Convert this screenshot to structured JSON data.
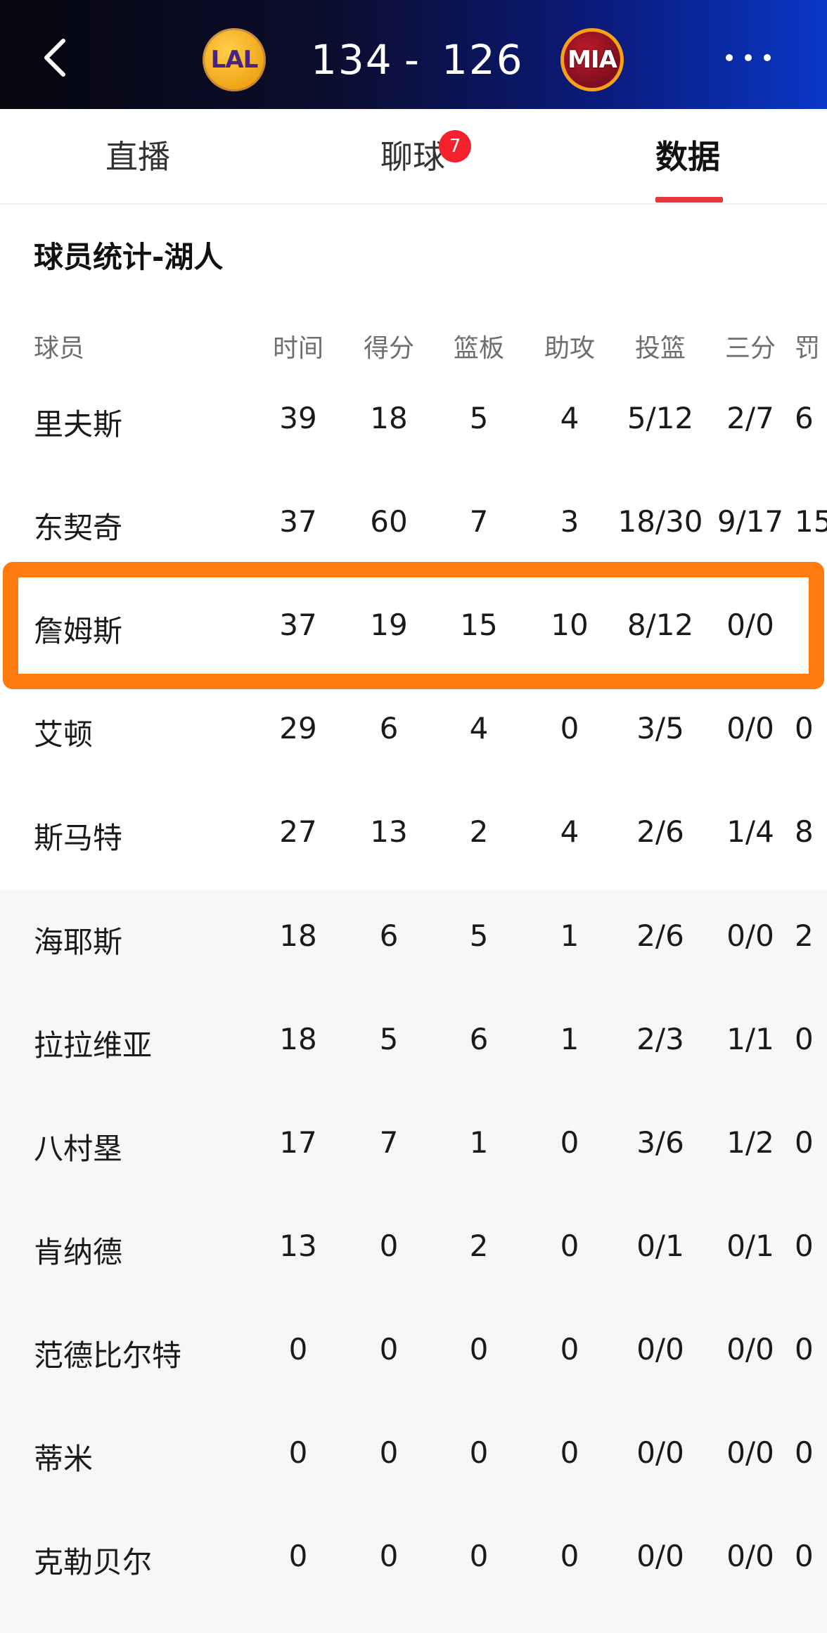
{
  "header": {
    "home_logo_text": "LAL",
    "away_logo_text": "MIA",
    "home_score": "134",
    "separator": "-",
    "away_score": "126"
  },
  "tabs": [
    {
      "label": "直播"
    },
    {
      "label": "聊球",
      "badge": "7"
    },
    {
      "label": "数据",
      "active": true
    }
  ],
  "section_title": "球员统计-湖人",
  "columns": [
    "球员",
    "时间",
    "得分",
    "篮板",
    "助攻",
    "投篮",
    "三分",
    "罚"
  ],
  "rows": [
    {
      "name": "里夫斯",
      "time": "39",
      "pts": "18",
      "reb": "5",
      "ast": "4",
      "fg": "5/12",
      "tp": "2/7",
      "ft": "6"
    },
    {
      "name": "东契奇",
      "time": "37",
      "pts": "60",
      "reb": "7",
      "ast": "3",
      "fg": "18/30",
      "tp": "9/17",
      "ft": "15"
    },
    {
      "name": "詹姆斯",
      "time": "37",
      "pts": "19",
      "reb": "15",
      "ast": "10",
      "fg": "8/12",
      "tp": "0/0",
      "ft": ""
    },
    {
      "name": "艾顿",
      "time": "29",
      "pts": "6",
      "reb": "4",
      "ast": "0",
      "fg": "3/5",
      "tp": "0/0",
      "ft": "0"
    },
    {
      "name": "斯马特",
      "time": "27",
      "pts": "13",
      "reb": "2",
      "ast": "4",
      "fg": "2/6",
      "tp": "1/4",
      "ft": "8"
    },
    {
      "name": "海耶斯",
      "time": "18",
      "pts": "6",
      "reb": "5",
      "ast": "1",
      "fg": "2/6",
      "tp": "0/0",
      "ft": "2"
    },
    {
      "name": "拉拉维亚",
      "time": "18",
      "pts": "5",
      "reb": "6",
      "ast": "1",
      "fg": "2/3",
      "tp": "1/1",
      "ft": "0"
    },
    {
      "name": "八村塁",
      "time": "17",
      "pts": "7",
      "reb": "1",
      "ast": "0",
      "fg": "3/6",
      "tp": "1/2",
      "ft": "0"
    },
    {
      "name": "肯纳德",
      "time": "13",
      "pts": "0",
      "reb": "2",
      "ast": "0",
      "fg": "0/1",
      "tp": "0/1",
      "ft": "0"
    },
    {
      "name": "范德比尔特",
      "time": "0",
      "pts": "0",
      "reb": "0",
      "ast": "0",
      "fg": "0/0",
      "tp": "0/0",
      "ft": "0"
    },
    {
      "name": "蒂米",
      "time": "0",
      "pts": "0",
      "reb": "0",
      "ast": "0",
      "fg": "0/0",
      "tp": "0/0",
      "ft": "0"
    },
    {
      "name": "克勒贝尔",
      "time": "0",
      "pts": "0",
      "reb": "0",
      "ast": "0",
      "fg": "0/0",
      "tp": "0/0",
      "ft": "0"
    }
  ],
  "colors": {
    "highlight_border": "#ff7b0f",
    "tab_active_underline": "#e8373b",
    "badge": "#f5222d"
  }
}
